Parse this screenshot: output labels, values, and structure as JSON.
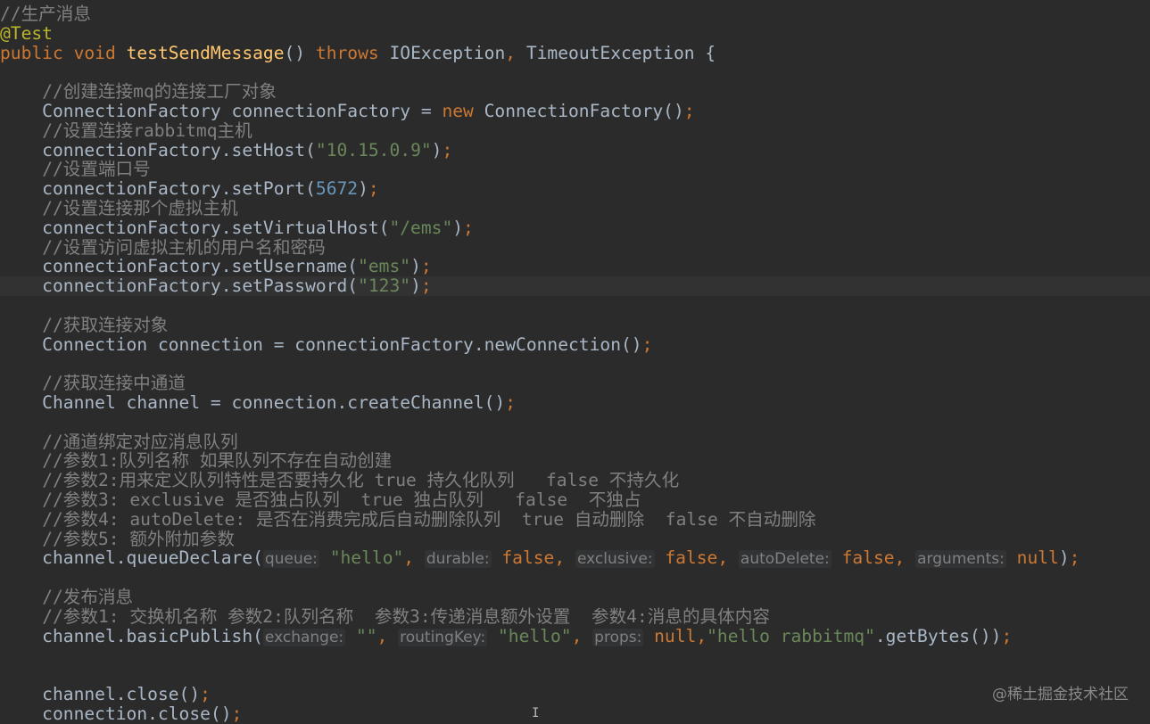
{
  "editor": {
    "language": "java",
    "current_line": 14,
    "lines": [
      [
        {
          "t": "comment",
          "v": "//生产消息"
        }
      ],
      [
        {
          "t": "annotation",
          "v": "@Test"
        }
      ],
      [
        {
          "t": "keyword",
          "v": "public void "
        },
        {
          "t": "method",
          "v": "testSendMessage"
        },
        {
          "t": "plain",
          "v": "() "
        },
        {
          "t": "keyword",
          "v": "throws "
        },
        {
          "t": "plain",
          "v": "IOException"
        },
        {
          "t": "punct",
          "v": ", "
        },
        {
          "t": "plain",
          "v": "TimeoutException {"
        }
      ],
      [],
      [
        {
          "t": "plain",
          "v": "    "
        },
        {
          "t": "comment",
          "v": "//创建连接mq的连接工厂对象"
        }
      ],
      [
        {
          "t": "plain",
          "v": "    ConnectionFactory connectionFactory = "
        },
        {
          "t": "keyword",
          "v": "new "
        },
        {
          "t": "plain",
          "v": "ConnectionFactory()"
        },
        {
          "t": "punct",
          "v": ";"
        }
      ],
      [
        {
          "t": "plain",
          "v": "    "
        },
        {
          "t": "comment",
          "v": "//设置连接rabbitmq主机"
        }
      ],
      [
        {
          "t": "plain",
          "v": "    connectionFactory.setHost("
        },
        {
          "t": "string",
          "v": "\"10.15.0.9\""
        },
        {
          "t": "plain",
          "v": ")"
        },
        {
          "t": "punct",
          "v": ";"
        }
      ],
      [
        {
          "t": "plain",
          "v": "    "
        },
        {
          "t": "comment",
          "v": "//设置端口号"
        }
      ],
      [
        {
          "t": "plain",
          "v": "    connectionFactory.setPort("
        },
        {
          "t": "number",
          "v": "5672"
        },
        {
          "t": "plain",
          "v": ")"
        },
        {
          "t": "punct",
          "v": ";"
        }
      ],
      [
        {
          "t": "plain",
          "v": "    "
        },
        {
          "t": "comment",
          "v": "//设置连接那个虚拟主机"
        }
      ],
      [
        {
          "t": "plain",
          "v": "    connectionFactory.setVirtualHost("
        },
        {
          "t": "string",
          "v": "\"/ems\""
        },
        {
          "t": "plain",
          "v": ")"
        },
        {
          "t": "punct",
          "v": ";"
        }
      ],
      [
        {
          "t": "plain",
          "v": "    "
        },
        {
          "t": "comment",
          "v": "//设置访问虚拟主机的用户名和密码"
        }
      ],
      [
        {
          "t": "plain",
          "v": "    connectionFactory.setUsername("
        },
        {
          "t": "string",
          "v": "\"ems\""
        },
        {
          "t": "plain",
          "v": ")"
        },
        {
          "t": "punct",
          "v": ";"
        }
      ],
      [
        {
          "t": "plain",
          "v": "    connectionFactory.setPassword("
        },
        {
          "t": "string",
          "v": "\"123\""
        },
        {
          "t": "plain",
          "v": ")"
        },
        {
          "t": "punct",
          "v": ";"
        }
      ],
      [],
      [
        {
          "t": "plain",
          "v": "    "
        },
        {
          "t": "comment",
          "v": "//获取连接对象"
        }
      ],
      [
        {
          "t": "plain",
          "v": "    Connection connection = connectionFactory.newConnection()"
        },
        {
          "t": "punct",
          "v": ";"
        }
      ],
      [],
      [
        {
          "t": "plain",
          "v": "    "
        },
        {
          "t": "comment",
          "v": "//获取连接中通道"
        }
      ],
      [
        {
          "t": "plain",
          "v": "    Channel channel = connection.createChannel()"
        },
        {
          "t": "punct",
          "v": ";"
        }
      ],
      [],
      [
        {
          "t": "plain",
          "v": "    "
        },
        {
          "t": "comment",
          "v": "//通道绑定对应消息队列"
        }
      ],
      [
        {
          "t": "plain",
          "v": "    "
        },
        {
          "t": "comment",
          "v": "//参数1:队列名称 如果队列不存在自动创建"
        }
      ],
      [
        {
          "t": "plain",
          "v": "    "
        },
        {
          "t": "comment",
          "v": "//参数2:用来定义队列特性是否要持久化 true 持久化队列   false 不持久化"
        }
      ],
      [
        {
          "t": "plain",
          "v": "    "
        },
        {
          "t": "comment",
          "v": "//参数3: exclusive 是否独占队列  true 独占队列   false  不独占"
        }
      ],
      [
        {
          "t": "plain",
          "v": "    "
        },
        {
          "t": "comment",
          "v": "//参数4: autoDelete: 是否在消费完成后自动删除队列  true 自动删除  false 不自动删除"
        }
      ],
      [
        {
          "t": "plain",
          "v": "    "
        },
        {
          "t": "comment",
          "v": "//参数5: 额外附加参数"
        }
      ],
      [
        {
          "t": "plain",
          "v": "    channel.queueDeclare("
        },
        {
          "t": "hint",
          "v": "queue:"
        },
        {
          "t": "plain",
          "v": " "
        },
        {
          "t": "string",
          "v": "\"hello\""
        },
        {
          "t": "punct",
          "v": ", "
        },
        {
          "t": "hint",
          "v": "durable:"
        },
        {
          "t": "plain",
          "v": " "
        },
        {
          "t": "keyword",
          "v": "false"
        },
        {
          "t": "punct",
          "v": ", "
        },
        {
          "t": "hint",
          "v": "exclusive:"
        },
        {
          "t": "plain",
          "v": " "
        },
        {
          "t": "keyword",
          "v": "false"
        },
        {
          "t": "punct",
          "v": ", "
        },
        {
          "t": "hint",
          "v": "autoDelete:"
        },
        {
          "t": "plain",
          "v": " "
        },
        {
          "t": "keyword",
          "v": "false"
        },
        {
          "t": "punct",
          "v": ", "
        },
        {
          "t": "hint",
          "v": "arguments:"
        },
        {
          "t": "plain",
          "v": " "
        },
        {
          "t": "keyword",
          "v": "null"
        },
        {
          "t": "plain",
          "v": ")"
        },
        {
          "t": "punct",
          "v": ";"
        }
      ],
      [],
      [
        {
          "t": "plain",
          "v": "    "
        },
        {
          "t": "comment",
          "v": "//发布消息"
        }
      ],
      [
        {
          "t": "plain",
          "v": "    "
        },
        {
          "t": "comment",
          "v": "//参数1: 交换机名称 参数2:队列名称  参数3:传递消息额外设置  参数4:消息的具体内容"
        }
      ],
      [
        {
          "t": "plain",
          "v": "    channel.basicPublish("
        },
        {
          "t": "hint",
          "v": "exchange:"
        },
        {
          "t": "plain",
          "v": " "
        },
        {
          "t": "string",
          "v": "\"\""
        },
        {
          "t": "punct",
          "v": ", "
        },
        {
          "t": "hint",
          "v": "routingKey:"
        },
        {
          "t": "plain",
          "v": " "
        },
        {
          "t": "string",
          "v": "\"hello\""
        },
        {
          "t": "punct",
          "v": ", "
        },
        {
          "t": "hint",
          "v": "props:"
        },
        {
          "t": "plain",
          "v": " "
        },
        {
          "t": "keyword",
          "v": "null"
        },
        {
          "t": "punct",
          "v": ","
        },
        {
          "t": "string",
          "v": "\"hello rabbitmq\""
        },
        {
          "t": "plain",
          "v": ".getBytes())"
        },
        {
          "t": "punct",
          "v": ";"
        }
      ],
      [],
      [],
      [
        {
          "t": "plain",
          "v": "    channel.close()"
        },
        {
          "t": "punct",
          "v": ";"
        }
      ],
      [
        {
          "t": "plain",
          "v": "    connection.close()"
        },
        {
          "t": "punct",
          "v": ";"
        }
      ]
    ]
  },
  "watermark": "@稀土掘金技术社区",
  "cursor_glyph": "I",
  "colors": {
    "background": "#2b2b2b",
    "comment": "#808080",
    "keyword": "#cc7832",
    "method": "#ffc66d",
    "string": "#6a8759",
    "number": "#6897bb",
    "annotation": "#bbb529",
    "plain": "#a9b7c6"
  }
}
